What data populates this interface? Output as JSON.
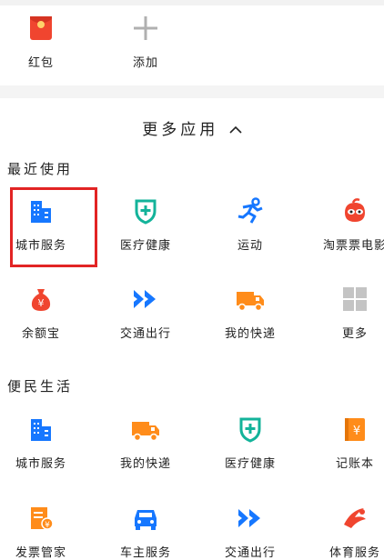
{
  "top_row": [
    {
      "label": "红包",
      "icon": "red-envelope-icon"
    },
    {
      "label": "添加",
      "icon": "plus-icon"
    }
  ],
  "more_apps": {
    "title": "更多应用",
    "chevron": "chevron-up-icon"
  },
  "recent": {
    "title": "最近使用",
    "items": [
      {
        "label": "城市服务",
        "icon": "city-building-icon"
      },
      {
        "label": "医疗健康",
        "icon": "medical-shield-icon"
      },
      {
        "label": "运动",
        "icon": "running-person-icon"
      },
      {
        "label": "淘票票电影",
        "icon": "movie-ticket-icon"
      },
      {
        "label": "余额宝",
        "icon": "money-bag-icon"
      },
      {
        "label": "交通出行",
        "icon": "double-chevron-icon"
      },
      {
        "label": "我的快递",
        "icon": "delivery-truck-icon"
      },
      {
        "label": "更多",
        "icon": "grid-icon"
      }
    ]
  },
  "life": {
    "title": "便民生活",
    "items": [
      {
        "label": "城市服务",
        "icon": "city-building-icon"
      },
      {
        "label": "我的快递",
        "icon": "delivery-truck-icon"
      },
      {
        "label": "医疗健康",
        "icon": "medical-shield-icon"
      },
      {
        "label": "记账本",
        "icon": "account-book-icon"
      },
      {
        "label": "发票管家",
        "icon": "invoice-icon"
      },
      {
        "label": "车主服务",
        "icon": "car-icon"
      },
      {
        "label": "交通出行",
        "icon": "double-chevron-icon"
      },
      {
        "label": "体育服务",
        "icon": "sports-icon"
      }
    ]
  },
  "colors": {
    "blue": "#1677ff",
    "teal": "#13b39a",
    "orange": "#ff8c1a",
    "red": "#f0452f",
    "highlight": "#e22424"
  }
}
